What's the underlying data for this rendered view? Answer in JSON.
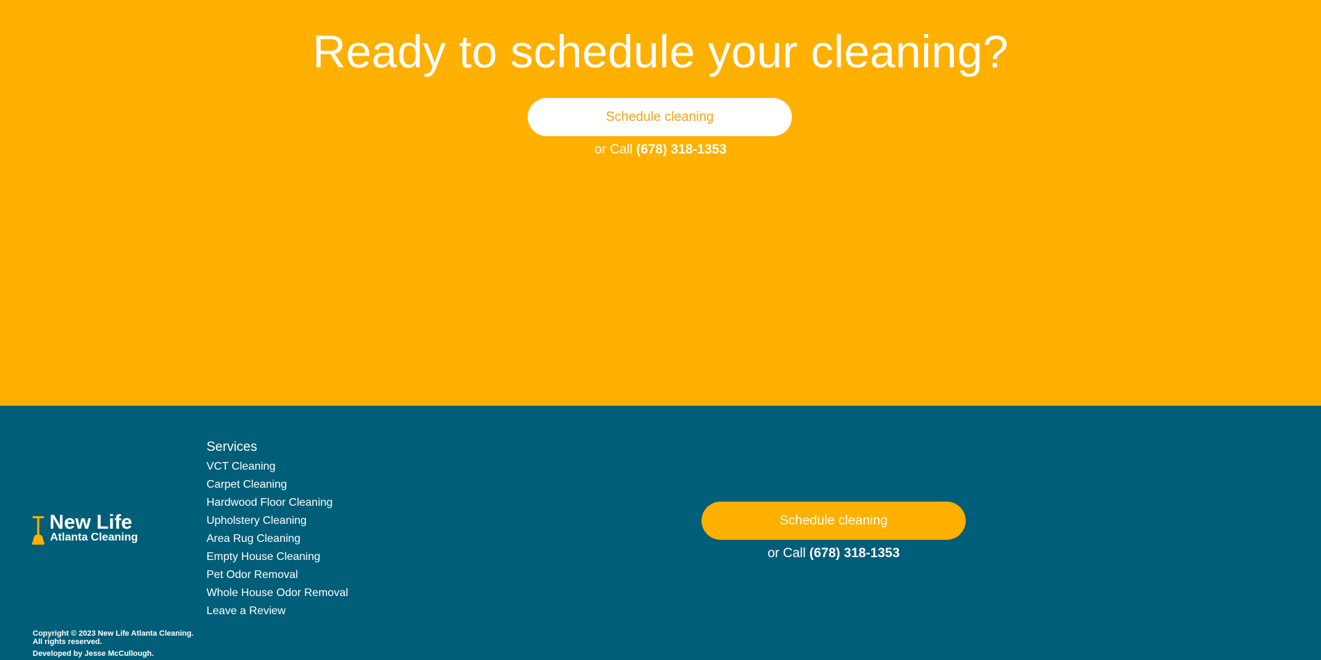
{
  "cta": {
    "title": "Ready to schedule your cleaning?",
    "button_label": "Schedule cleaning",
    "call_prefix": "or Call ",
    "phone": "(678) 318-1353"
  },
  "footer": {
    "logo": {
      "line1": "New Life",
      "line2": "Atlanta Cleaning"
    },
    "services_heading": "Services",
    "services": [
      "VCT Cleaning",
      "Carpet Cleaning",
      "Hardwood Floor Cleaning",
      "Upholstery Cleaning",
      "Area Rug Cleaning",
      "Empty House Cleaning",
      "Pet Odor Removal",
      "Whole House Odor Removal",
      "Leave a Review"
    ],
    "button_label": "Schedule cleaning",
    "call_prefix": "or Call ",
    "phone": "(678) 318-1353",
    "copyright_line1": "Copyright © 2023 New Life Atlanta Cleaning.",
    "copyright_line2": "All rights reserved.",
    "developer": "Developed by Jesse McCullough."
  },
  "colors": {
    "cta_background": "#ffb000",
    "footer_background": "#015e78",
    "cta_button_text": "#f2a31a",
    "white": "#ffffff"
  },
  "icons": {
    "logo_mark": "floor-buffer-icon"
  }
}
